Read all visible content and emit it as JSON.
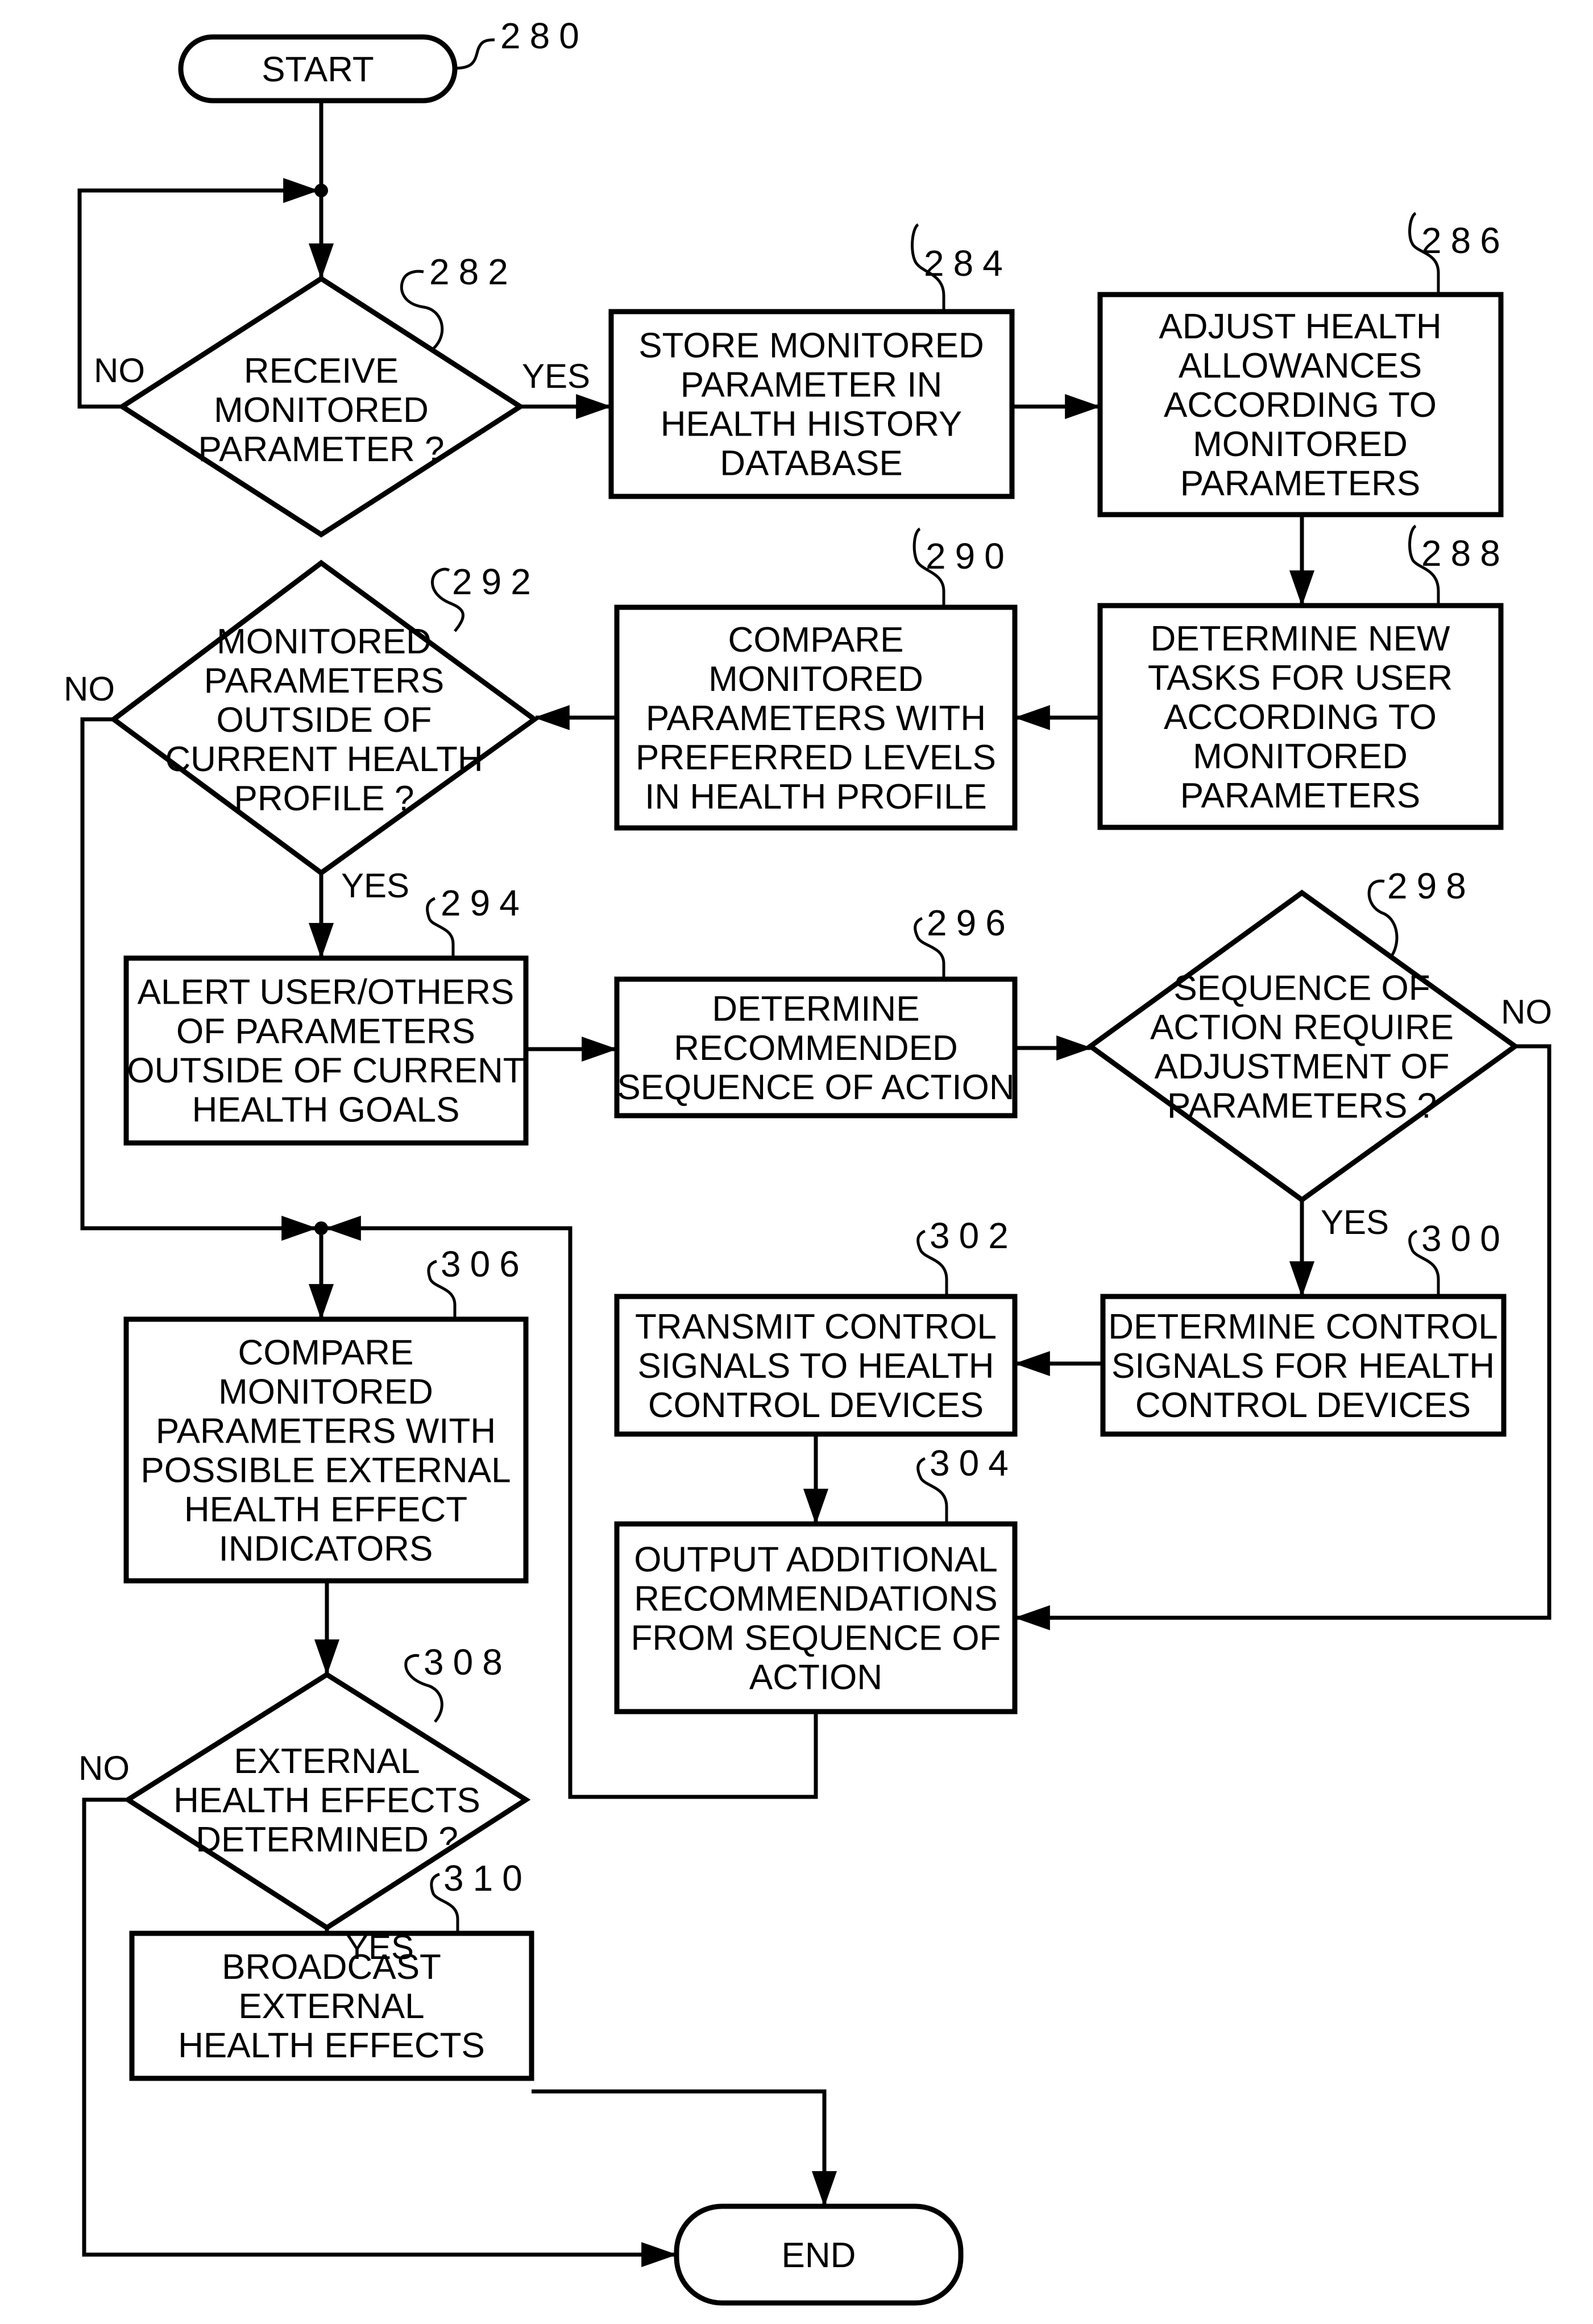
{
  "figure": {
    "nodes": [
      {
        "id": "280",
        "type": "terminator",
        "ref": "280",
        "lines": [
          "START"
        ]
      },
      {
        "id": "282",
        "type": "decision",
        "ref": "282",
        "lines": [
          "RECEIVE",
          "MONITORED",
          "PARAMETER ?"
        ]
      },
      {
        "id": "284",
        "type": "process",
        "ref": "284",
        "lines": [
          "STORE MONITORED",
          "PARAMETER IN",
          "HEALTH HISTORY",
          "DATABASE"
        ]
      },
      {
        "id": "286",
        "type": "process",
        "ref": "286",
        "lines": [
          "ADJUST HEALTH",
          "ALLOWANCES",
          "ACCORDING TO",
          "MONITORED",
          "PARAMETERS"
        ]
      },
      {
        "id": "288",
        "type": "process",
        "ref": "288",
        "lines": [
          "DETERMINE NEW",
          "TASKS FOR USER",
          "ACCORDING TO",
          "MONITORED",
          "PARAMETERS"
        ]
      },
      {
        "id": "290",
        "type": "process",
        "ref": "290",
        "lines": [
          "COMPARE",
          "MONITORED",
          "PARAMETERS WITH",
          "PREFERRED LEVELS",
          "IN HEALTH PROFILE"
        ]
      },
      {
        "id": "292",
        "type": "decision",
        "ref": "292",
        "lines": [
          "MONITORED",
          "PARAMETERS",
          "OUTSIDE OF",
          "CURRENT HEALTH",
          "PROFILE ?"
        ]
      },
      {
        "id": "294",
        "type": "process",
        "ref": "294",
        "lines": [
          "ALERT USER/OTHERS",
          "OF PARAMETERS",
          "OUTSIDE OF CURRENT",
          "HEALTH GOALS"
        ]
      },
      {
        "id": "296",
        "type": "process",
        "ref": "296",
        "lines": [
          "DETERMINE",
          "RECOMMENDED",
          "SEQUENCE OF ACTION"
        ]
      },
      {
        "id": "298",
        "type": "decision",
        "ref": "298",
        "lines": [
          "SEQUENCE OF",
          "ACTION REQUIRE",
          "ADJUSTMENT OF",
          "PARAMETERS ?"
        ]
      },
      {
        "id": "300",
        "type": "process",
        "ref": "300",
        "lines": [
          "DETERMINE CONTROL",
          "SIGNALS FOR HEALTH",
          "CONTROL DEVICES"
        ]
      },
      {
        "id": "302",
        "type": "process",
        "ref": "302",
        "lines": [
          "TRANSMIT CONTROL",
          "SIGNALS TO HEALTH",
          "CONTROL DEVICES"
        ]
      },
      {
        "id": "304",
        "type": "process",
        "ref": "304",
        "lines": [
          "OUTPUT ADDITIONAL",
          "RECOMMENDATIONS",
          "FROM SEQUENCE OF",
          "ACTION"
        ]
      },
      {
        "id": "306",
        "type": "process",
        "ref": "306",
        "lines": [
          "COMPARE",
          "MONITORED",
          "PARAMETERS WITH",
          "POSSIBLE EXTERNAL",
          "HEALTH EFFECT",
          "INDICATORS"
        ]
      },
      {
        "id": "308",
        "type": "decision",
        "ref": "308",
        "lines": [
          "EXTERNAL",
          "HEALTH EFFECTS",
          "DETERMINED ?"
        ]
      },
      {
        "id": "310",
        "type": "process",
        "ref": "310",
        "lines": [
          "BROADCAST",
          "EXTERNAL",
          "HEALTH EFFECTS"
        ]
      },
      {
        "id": "end",
        "type": "terminator",
        "ref": "",
        "lines": [
          "END"
        ]
      }
    ],
    "branch_labels": {
      "282_no": "NO",
      "282_yes": "YES",
      "292_no": "NO",
      "292_yes": "YES",
      "298_no": "NO",
      "298_yes": "YES",
      "308_no": "NO",
      "308_yes": "YES"
    },
    "edges": [
      {
        "from": "280",
        "to": "282"
      },
      {
        "from": "282",
        "to": "282",
        "label": "NO"
      },
      {
        "from": "282",
        "to": "284",
        "label": "YES"
      },
      {
        "from": "284",
        "to": "286"
      },
      {
        "from": "286",
        "to": "288"
      },
      {
        "from": "288",
        "to": "290"
      },
      {
        "from": "290",
        "to": "292"
      },
      {
        "from": "292",
        "to": "294",
        "label": "YES"
      },
      {
        "from": "292",
        "to": "306",
        "label": "NO"
      },
      {
        "from": "294",
        "to": "296"
      },
      {
        "from": "296",
        "to": "298"
      },
      {
        "from": "298",
        "to": "300",
        "label": "YES"
      },
      {
        "from": "298",
        "to": "304",
        "label": "NO"
      },
      {
        "from": "300",
        "to": "302"
      },
      {
        "from": "302",
        "to": "304"
      },
      {
        "from": "304",
        "to": "306"
      },
      {
        "from": "306",
        "to": "308"
      },
      {
        "from": "308",
        "to": "310",
        "label": "YES"
      },
      {
        "from": "308",
        "to": "end",
        "label": "NO"
      },
      {
        "from": "310",
        "to": "end"
      }
    ]
  }
}
